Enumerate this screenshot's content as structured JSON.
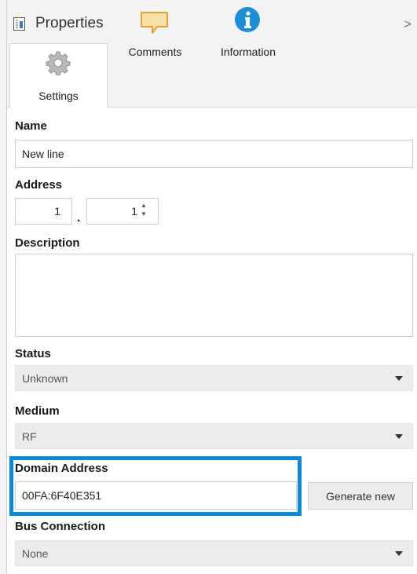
{
  "header": {
    "title": "Properties",
    "title_icon": "properties-document-icon",
    "collapse_icon": "chevron-right-icon",
    "collapse_glyph": ">"
  },
  "tabs": [
    {
      "label": "Settings",
      "icon": "gear-icon",
      "active": true
    },
    {
      "label": "Comments",
      "icon": "speech-bubble-icon",
      "active": false
    },
    {
      "label": "Information",
      "icon": "info-icon",
      "active": false
    }
  ],
  "fields": {
    "name": {
      "label": "Name",
      "value": "New line"
    },
    "address": {
      "label": "Address",
      "area": "1",
      "separator": ".",
      "line": "1"
    },
    "description": {
      "label": "Description",
      "value": ""
    },
    "status": {
      "label": "Status",
      "value": "Unknown"
    },
    "medium": {
      "label": "Medium",
      "value": "RF"
    },
    "domain_address": {
      "label": "Domain Address",
      "value": "00FA:6F40E351",
      "button_label": "Generate new"
    },
    "bus_connection": {
      "label": "Bus Connection",
      "value": "None"
    }
  },
  "colors": {
    "highlight": "#0c8ad6",
    "info_icon": "#1c8fd6",
    "comment_icon": "#f0b24a"
  }
}
